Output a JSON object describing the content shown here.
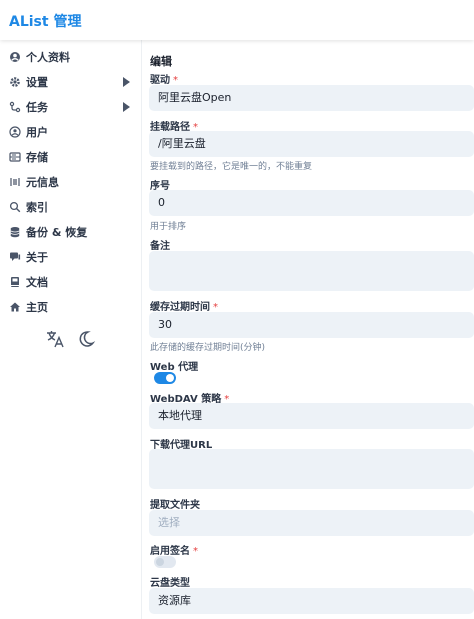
{
  "app": {
    "title": "AList 管理"
  },
  "sidebar": {
    "items": [
      {
        "label": "个人资料"
      },
      {
        "label": "设置"
      },
      {
        "label": "任务"
      },
      {
        "label": "用户"
      },
      {
        "label": "存储"
      },
      {
        "label": "元信息"
      },
      {
        "label": "索引"
      },
      {
        "label": "备份 & 恢复"
      },
      {
        "label": "关于"
      },
      {
        "label": "文档"
      },
      {
        "label": "主页"
      }
    ]
  },
  "form": {
    "title": "编辑",
    "driver": {
      "label": "驱动",
      "value": "阿里云盘Open"
    },
    "mount_path": {
      "label": "挂载路径",
      "value": "/阿里云盘",
      "help": "要挂载到的路径，它是唯一的，不能重复"
    },
    "order": {
      "label": "序号",
      "value": "0",
      "help": "用于排序"
    },
    "remark": {
      "label": "备注"
    },
    "cache_expiration": {
      "label": "缓存过期时间",
      "value": "30",
      "help": "此存储的缓存过期时间(分钟)"
    },
    "web_proxy": {
      "label": "Web 代理",
      "on": true
    },
    "webdav_policy": {
      "label": "WebDAV 策略",
      "value": "本地代理"
    },
    "download_proxy_url": {
      "label": "下载代理URL"
    },
    "extract_folder": {
      "label": "提取文件夹",
      "placeholder": "选择"
    },
    "enable_sign": {
      "label": "启用签名",
      "on": false
    },
    "drive_type": {
      "label": "云盘类型",
      "value": "资源库"
    }
  },
  "colors": {
    "brand": "#1e88e5",
    "required": "#e53e3e",
    "input_bg": "#edf2f7"
  }
}
